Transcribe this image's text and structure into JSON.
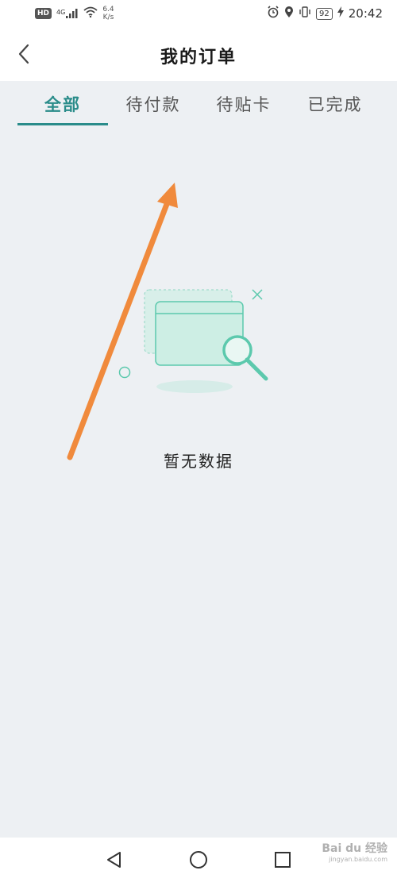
{
  "status_bar": {
    "hd": "HD",
    "signal": "4G",
    "net_speed_value": "6.4",
    "net_speed_unit": "K/s",
    "battery": "92",
    "time": "20:42"
  },
  "header": {
    "title": "我的订单",
    "back_icon": "chevron-left-icon"
  },
  "tabs": [
    {
      "label": "全部",
      "active": true
    },
    {
      "label": "待付款",
      "active": false
    },
    {
      "label": "待贴卡",
      "active": false
    },
    {
      "label": "已完成",
      "active": false
    }
  ],
  "empty_state": {
    "text": "暂无数据",
    "icon": "empty-search-icon"
  },
  "colors": {
    "accent": "#2a8c8a",
    "illustration": "#5cc9ad",
    "annotation_arrow": "#f08a3c",
    "background": "#edf0f3"
  },
  "nav_bar": {
    "back_icon": "triangle-back-icon",
    "home_icon": "circle-home-icon",
    "recents_icon": "square-recents-icon"
  },
  "watermark": {
    "brand": "Bai du 经验",
    "url": "jingyan.baidu.com"
  }
}
